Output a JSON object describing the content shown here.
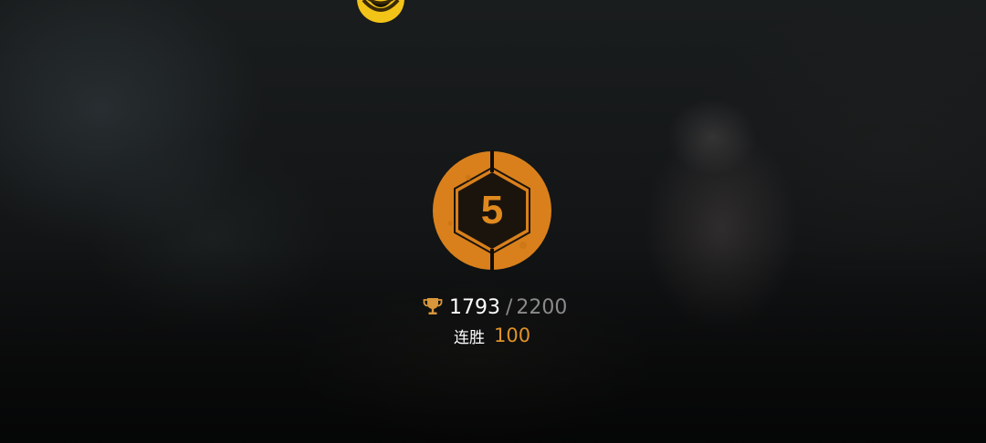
{
  "rank": {
    "level": "5",
    "badge_icon": "hexagon-rank-badge-icon",
    "badge_color": "#d9801c"
  },
  "score": {
    "icon": "trophy-icon",
    "current": "1793",
    "separator": "/",
    "max": "2200"
  },
  "streak": {
    "label": "连胜",
    "value": "100"
  },
  "top_emblem": {
    "icon": "yellow-emblem-icon",
    "color": "#f2c418"
  },
  "colors": {
    "accent_orange": "#e0922a",
    "text_white": "#ffffff",
    "text_grey": "#8a8a8a"
  }
}
